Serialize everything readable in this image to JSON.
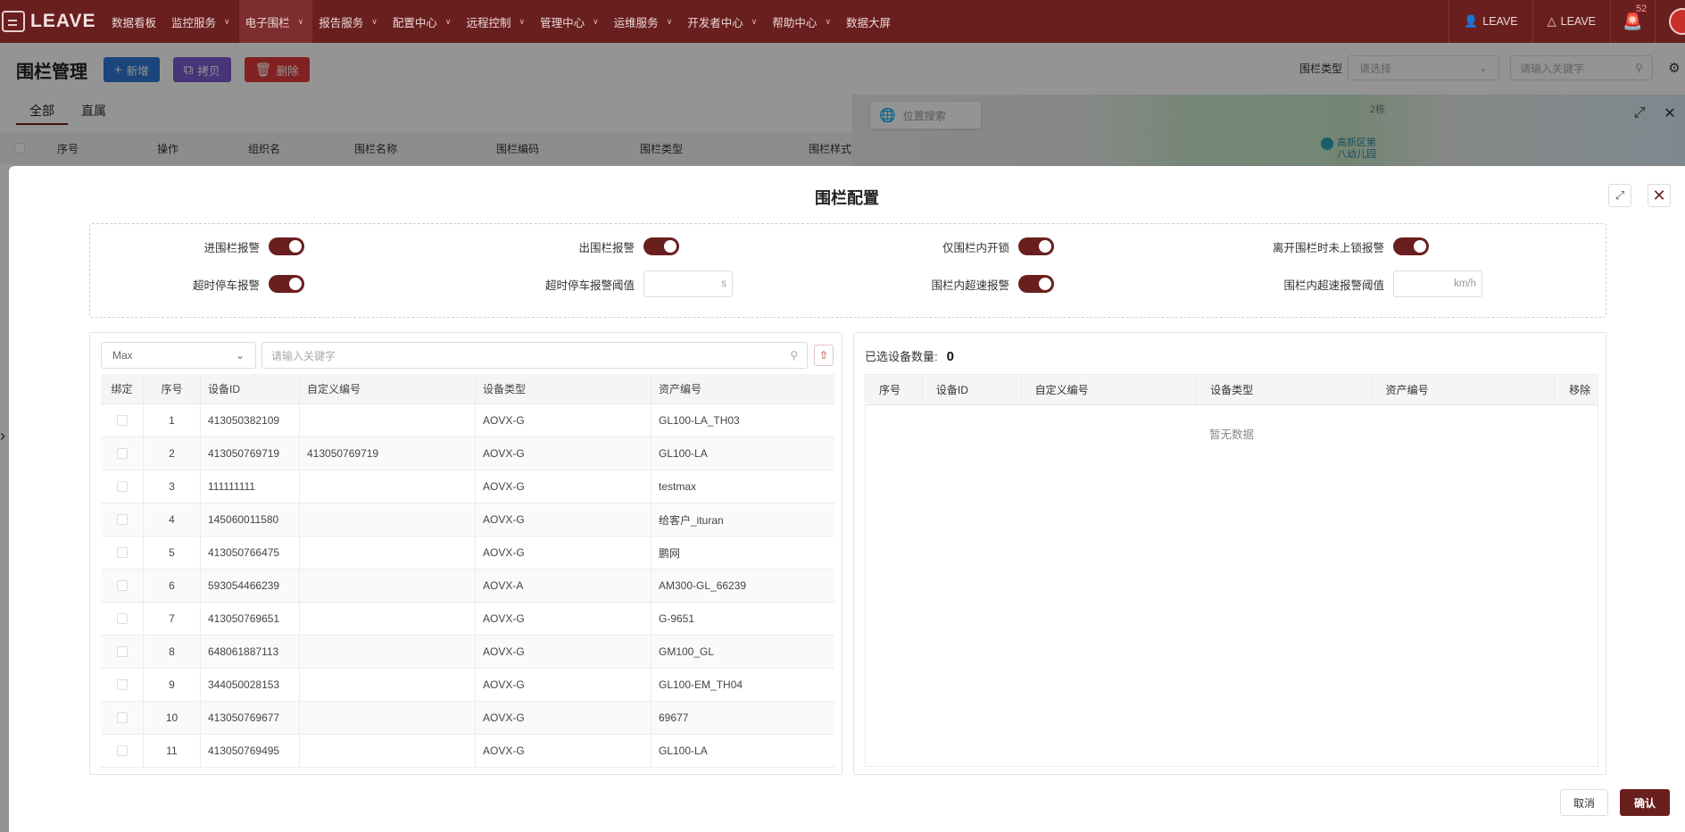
{
  "nav": {
    "logo": "LEAVE",
    "items": [
      {
        "label": "数据看板",
        "chevron": false
      },
      {
        "label": "监控服务",
        "chevron": true
      },
      {
        "label": "电子围栏",
        "chevron": true,
        "active": true
      },
      {
        "label": "报告服务",
        "chevron": true
      },
      {
        "label": "配置中心",
        "chevron": true
      },
      {
        "label": "远程控制",
        "chevron": true
      },
      {
        "label": "管理中心",
        "chevron": true
      },
      {
        "label": "运维服务",
        "chevron": true
      },
      {
        "label": "开发者中心",
        "chevron": true
      },
      {
        "label": "帮助中心",
        "chevron": true
      },
      {
        "label": "数据大屏",
        "chevron": false
      }
    ],
    "user1": "LEAVE",
    "user2": "LEAVE",
    "alarm_count": "52"
  },
  "page": {
    "title": "围栏管理",
    "btn_add": "新增",
    "btn_copy": "拷贝",
    "btn_delete": "删除",
    "filter_label": "围栏类型",
    "filter_placeholder": "请选择",
    "search_placeholder": "请输入关键字",
    "tabs": [
      "全部",
      "直属"
    ],
    "columns": [
      "序号",
      "操作",
      "组织名",
      "围栏名称",
      "围栏编码",
      "围栏类型",
      "围栏样式"
    ],
    "map_search_placeholder": "位置搜索",
    "map_label_building": "2栋",
    "map_poi": "高新区第八幼儿园"
  },
  "modal": {
    "title": "围栏配置",
    "settings": {
      "enter_alarm": "进围栏报警",
      "exit_alarm": "出围栏报警",
      "unlock_inside_only": "仅围栏内开锁",
      "leave_unlocked_alarm": "离开围栏时未上锁报警",
      "overtime_parking_alarm": "超时停车报警",
      "overtime_parking_threshold": "超时停车报警阈值",
      "overtime_parking_unit": "s",
      "overspeed_alarm": "围栏内超速报警",
      "overspeed_threshold": "围栏内超速报警阈值",
      "overspeed_unit": "km/h"
    },
    "left": {
      "model_select": "Max",
      "search_placeholder": "请输入关键字",
      "columns": [
        "绑定",
        "序号",
        "设备ID",
        "自定义编号",
        "设备类型",
        "资产编号"
      ],
      "rows": [
        {
          "no": "1",
          "id": "413050382109",
          "custom": "",
          "type": "AOVX-G",
          "asset": "GL100-LA_TH03"
        },
        {
          "no": "2",
          "id": "413050769719",
          "custom": "413050769719",
          "type": "AOVX-G",
          "asset": "GL100-LA"
        },
        {
          "no": "3",
          "id": "111111111",
          "custom": "",
          "type": "AOVX-G",
          "asset": "testmax"
        },
        {
          "no": "4",
          "id": "145060011580",
          "custom": "",
          "type": "AOVX-G",
          "asset": "给客户_ituran"
        },
        {
          "no": "5",
          "id": "413050766475",
          "custom": "",
          "type": "AOVX-G",
          "asset": "鹏网"
        },
        {
          "no": "6",
          "id": "593054466239",
          "custom": "",
          "type": "AOVX-A",
          "asset": "AM300-GL_66239"
        },
        {
          "no": "7",
          "id": "413050769651",
          "custom": "",
          "type": "AOVX-G",
          "asset": "G-9651"
        },
        {
          "no": "8",
          "id": "648061887113",
          "custom": "",
          "type": "AOVX-G",
          "asset": "GM100_GL"
        },
        {
          "no": "9",
          "id": "344050028153",
          "custom": "",
          "type": "AOVX-G",
          "asset": "GL100-EM_TH04"
        },
        {
          "no": "10",
          "id": "413050769677",
          "custom": "",
          "type": "AOVX-G",
          "asset": "69677"
        },
        {
          "no": "11",
          "id": "413050769495",
          "custom": "",
          "type": "AOVX-G",
          "asset": "GL100-LA"
        }
      ]
    },
    "right": {
      "count_label": "已选设备数量:",
      "count": "0",
      "columns": [
        "序号",
        "设备ID",
        "自定义编号",
        "设备类型",
        "资产编号",
        "移除"
      ],
      "empty": "暂无数据"
    },
    "cancel": "取消",
    "confirm": "确认"
  }
}
